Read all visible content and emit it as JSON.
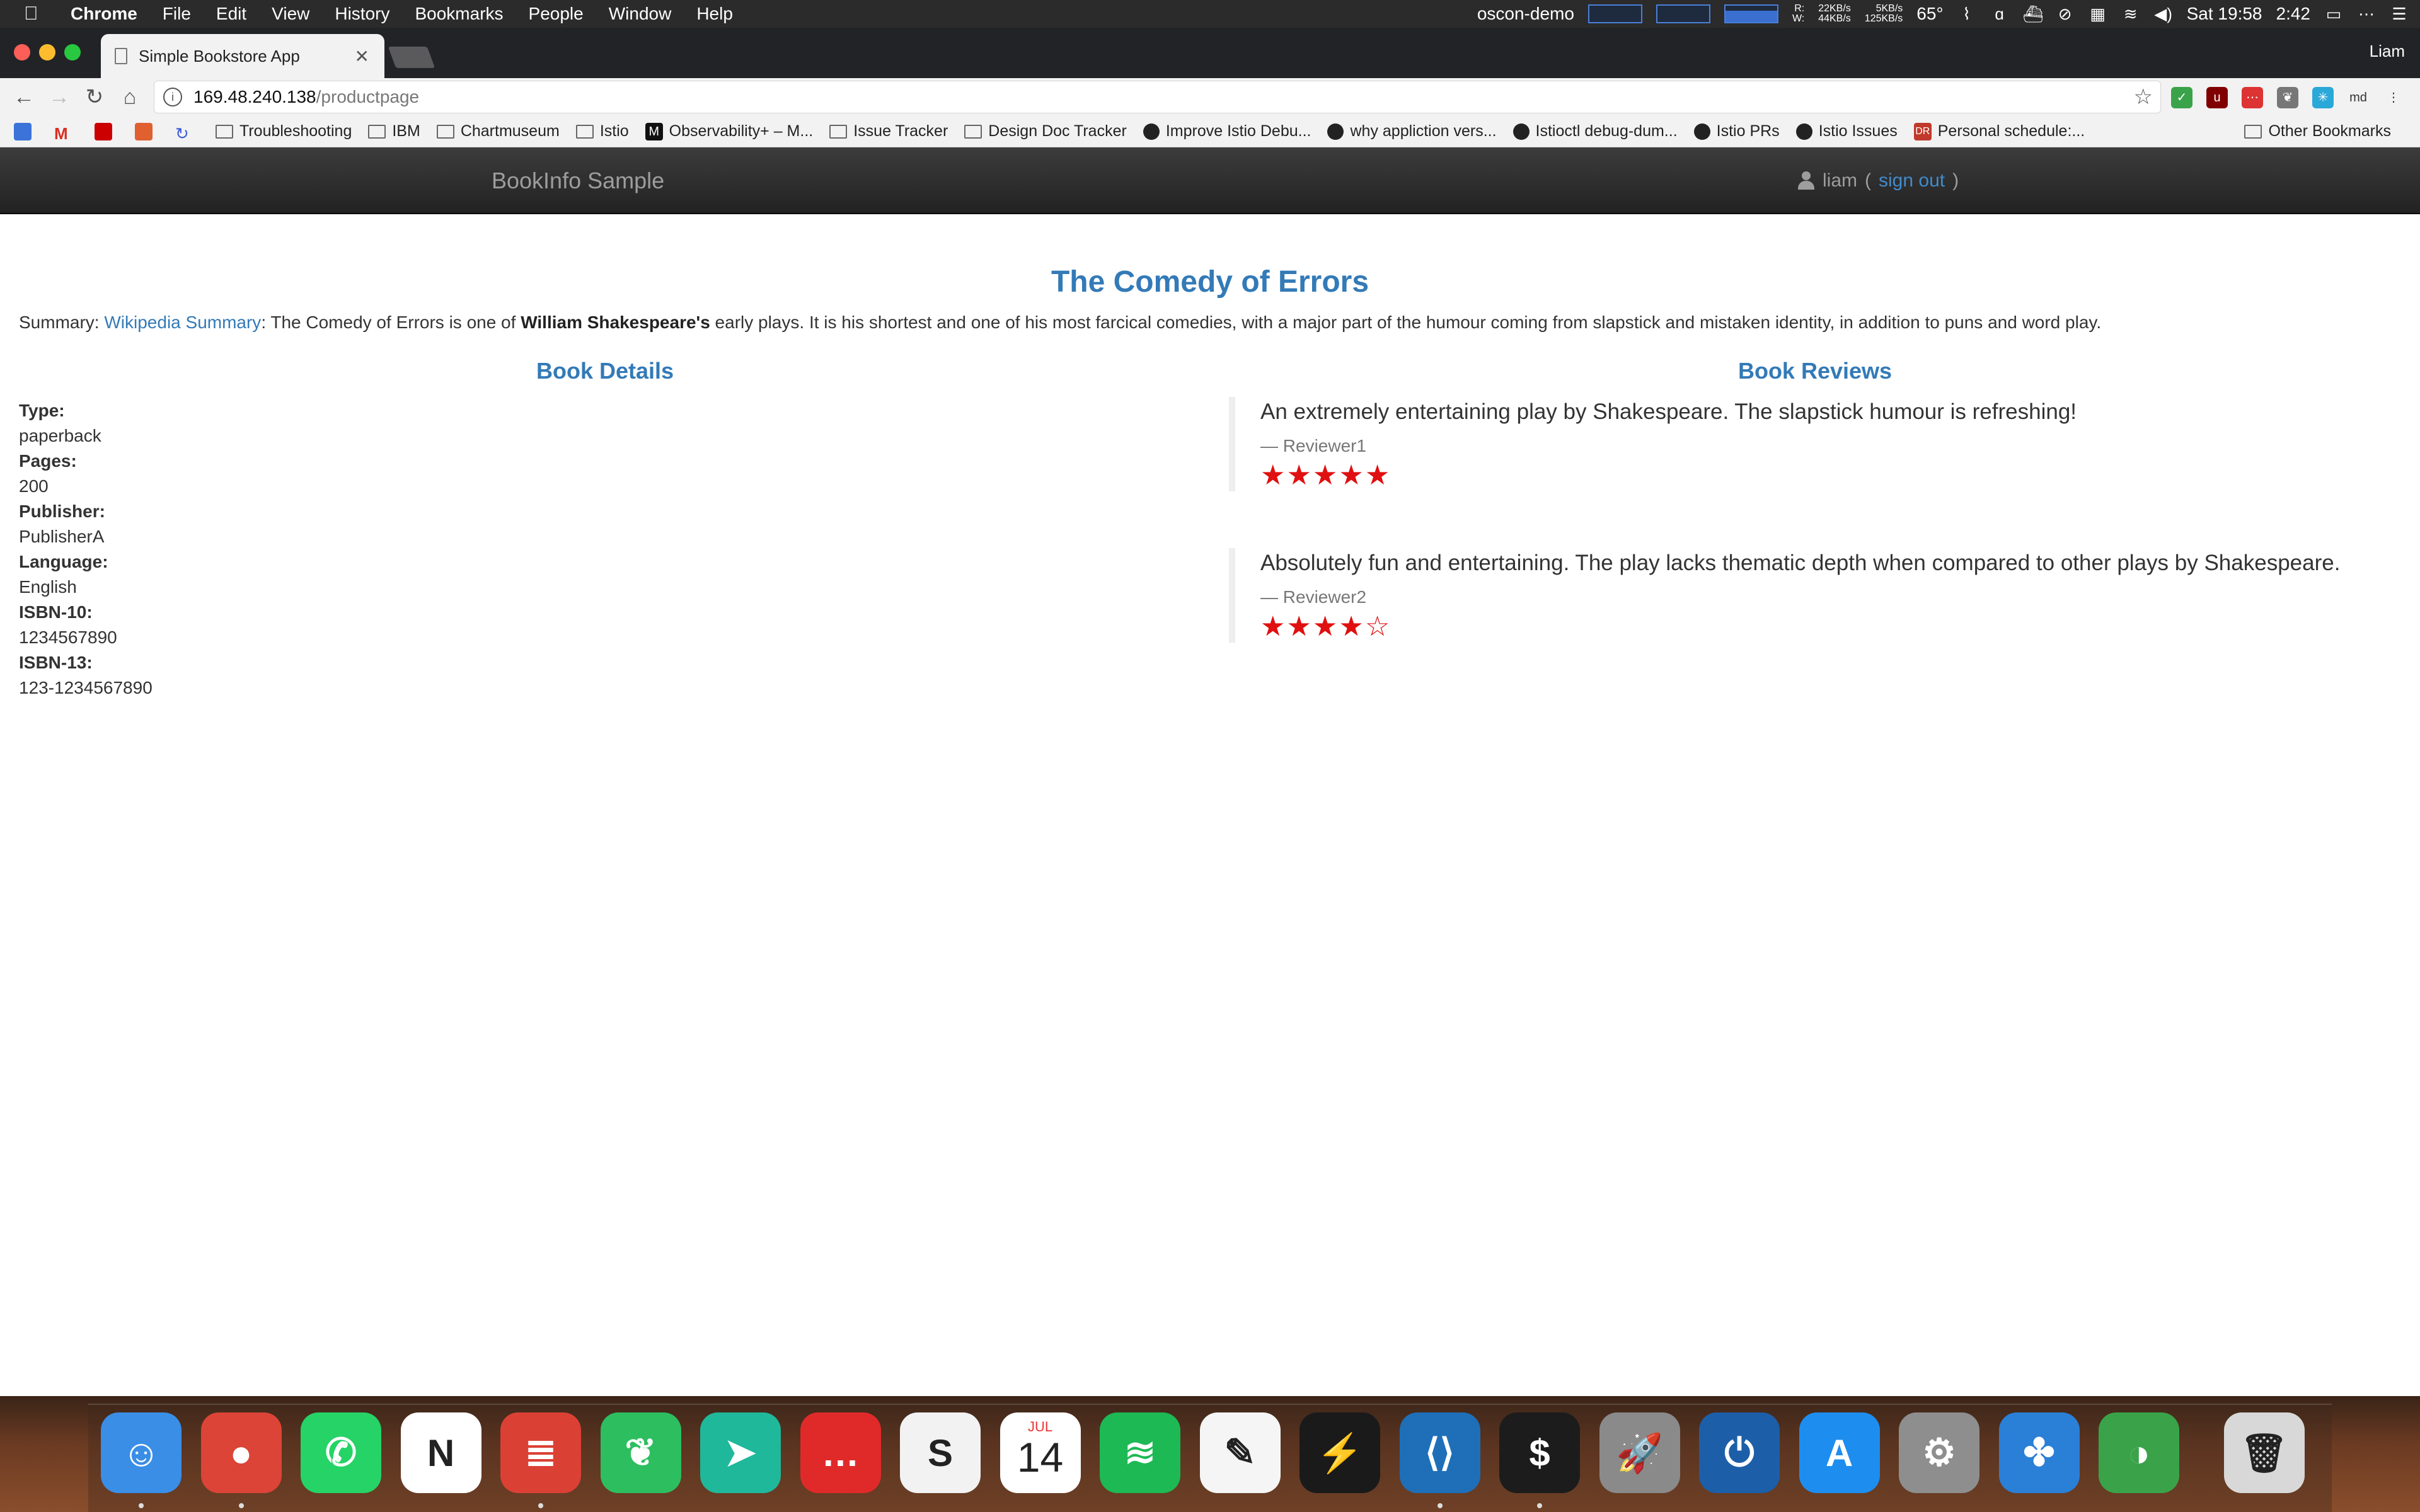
{
  "menubar": {
    "app": "Chrome",
    "items": [
      "File",
      "Edit",
      "View",
      "History",
      "Bookmarks",
      "People",
      "Window",
      "Help"
    ],
    "status_name": "oscon-demo",
    "net_rw_labels": "R:\nW:",
    "net_rates_a": "22KB/s\n44KB/s",
    "net_rates_b": "5KB/s\n125KB/s",
    "temperature": "65°",
    "clock": "Sat 19:58",
    "battery_time": "2:42"
  },
  "browser": {
    "tab_title": "Simple Bookstore App",
    "profile_name": "Liam",
    "url_host": "169.48.240.138",
    "url_path": "/productpage",
    "bookmarks": [
      {
        "label": "",
        "icon": "calendar-icon",
        "color": "#3b73d8"
      },
      {
        "label": "",
        "icon": "gmail-icon",
        "color": "#d93025"
      },
      {
        "label": "",
        "icon": "redhat-icon",
        "color": "#cc0000"
      },
      {
        "label": "",
        "icon": "pencil-icon",
        "color": "#e06030"
      },
      {
        "label": "",
        "icon": "refresh-icon",
        "color": "#3b5bdb"
      },
      {
        "label": "Troubleshooting",
        "icon": "folder-icon"
      },
      {
        "label": "IBM",
        "icon": "folder-icon"
      },
      {
        "label": "Chartmuseum",
        "icon": "folder-icon"
      },
      {
        "label": "Istio",
        "icon": "folder-icon"
      },
      {
        "label": "Observability+ – M...",
        "icon": "medium-icon"
      },
      {
        "label": "Issue Tracker",
        "icon": "folder-icon"
      },
      {
        "label": "Design Doc Tracker",
        "icon": "folder-icon"
      },
      {
        "label": "Improve Istio Debu...",
        "icon": "github-icon"
      },
      {
        "label": "why appliction vers...",
        "icon": "github-icon"
      },
      {
        "label": "Istioctl debug-dum...",
        "icon": "github-icon"
      },
      {
        "label": "Istio PRs",
        "icon": "github-icon"
      },
      {
        "label": "Istio Issues",
        "icon": "github-icon"
      },
      {
        "label": "Personal schedule:...",
        "icon": "dr-icon"
      }
    ],
    "other_bookmarks": "Other Bookmarks"
  },
  "app": {
    "brand": "BookInfo Sample",
    "user": "liam",
    "paren_open": "(",
    "sign_out": "sign out",
    "paren_close": ")"
  },
  "book": {
    "title": "The Comedy of Errors",
    "summary_prefix": "Summary: ",
    "summary_link": "Wikipedia Summary",
    "summary_mid": ": The Comedy of Errors is one of ",
    "summary_bold": "William Shakespeare's",
    "summary_rest": " early plays. It is his shortest and one of his most farcical comedies, with a major part of the humour coming from slapstick and mistaken identity, in addition to puns and word play."
  },
  "details": {
    "heading": "Book Details",
    "fields": [
      {
        "label": "Type:",
        "value": "paperback"
      },
      {
        "label": "Pages:",
        "value": "200"
      },
      {
        "label": "Publisher:",
        "value": "PublisherA"
      },
      {
        "label": "Language:",
        "value": "English"
      },
      {
        "label": "ISBN-10:",
        "value": "1234567890"
      },
      {
        "label": "ISBN-13:",
        "value": "123-1234567890"
      }
    ]
  },
  "reviews": {
    "heading": "Book Reviews",
    "items": [
      {
        "text": "An extremely entertaining play by Shakespeare. The slapstick humour is refreshing!",
        "reviewer": "— Reviewer1",
        "rating": 5,
        "max": 5
      },
      {
        "text": "Absolutely fun and entertaining. The play lacks thematic depth when compared to other plays by Shakespeare.",
        "reviewer": "— Reviewer2",
        "rating": 4,
        "max": 5
      }
    ],
    "star_color": "#e01010"
  },
  "dock": {
    "calendar_month": "JUL",
    "calendar_day": "14",
    "apps": [
      {
        "name": "finder-icon",
        "color": "#3a8ee6",
        "glyph": "☺"
      },
      {
        "name": "chrome-icon",
        "color": "#db4437",
        "glyph": "●"
      },
      {
        "name": "whatsapp-icon",
        "color": "#25d366",
        "glyph": "✆"
      },
      {
        "name": "notion-icon",
        "color": "#ffffff",
        "glyph": "N"
      },
      {
        "name": "todoist-icon",
        "color": "#db4035",
        "glyph": "≣"
      },
      {
        "name": "evernote-icon",
        "color": "#2dbe60",
        "glyph": "❦"
      },
      {
        "name": "telegram-icon",
        "color": "#1fb89b",
        "glyph": "➤"
      },
      {
        "name": "speech-icon",
        "color": "#e02a2a",
        "glyph": "…"
      },
      {
        "name": "slack-icon",
        "color": "#f2f2f2",
        "glyph": "S"
      },
      {
        "name": "calendar-icon",
        "color": "#ffffff",
        "glyph": ""
      },
      {
        "name": "spotify-icon",
        "color": "#1db954",
        "glyph": "≋"
      },
      {
        "name": "notes-icon",
        "color": "#f5f5f5",
        "glyph": "✎"
      },
      {
        "name": "reeder-icon",
        "color": "#1a1a1a",
        "glyph": "⚡"
      },
      {
        "name": "vscode-icon",
        "color": "#1e6fb8",
        "glyph": "⟨⟩"
      },
      {
        "name": "terminal-icon",
        "color": "#1c1c1c",
        "glyph": "$"
      },
      {
        "name": "launchpad-icon",
        "color": "#8a8a8a",
        "glyph": "🚀"
      },
      {
        "name": "timer-icon",
        "color": "#1d5ea8",
        "glyph": "⏻"
      },
      {
        "name": "appstore-icon",
        "color": "#1d8ef0",
        "glyph": "A"
      },
      {
        "name": "settings-icon",
        "color": "#8e8e8e",
        "glyph": "⚙"
      },
      {
        "name": "confluence-icon",
        "color": "#2a7fd6",
        "glyph": "✤"
      },
      {
        "name": "vpn-icon",
        "color": "#3aa34a",
        "glyph": "◑"
      },
      {
        "name": "trash-icon",
        "color": "#d8d8d8",
        "glyph": "🗑"
      }
    ]
  }
}
